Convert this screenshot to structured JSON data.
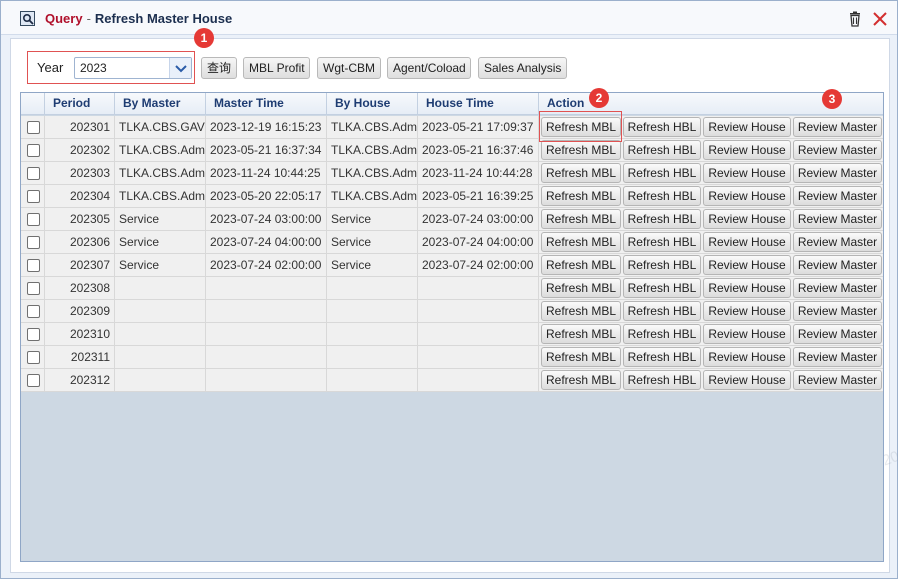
{
  "window": {
    "title_prefix": "Query",
    "title_separator": "-",
    "title_main": "Refresh Master House"
  },
  "toolbar": {
    "year_label": "Year",
    "year_value": "2023",
    "query_label": "查询",
    "mbl_profit_label": "MBL Profit",
    "wgt_cbm_label": "Wgt-CBM",
    "agent_coload_label": "Agent/Coload",
    "sales_analysis_label": "Sales Analysis"
  },
  "grid": {
    "columns": [
      "Period",
      "By Master",
      "Master Time",
      "By House",
      "House Time",
      "Action"
    ],
    "action_labels": {
      "refresh_mbl": "Refresh MBL",
      "refresh_hbl": "Refresh HBL",
      "review_house": "Review House",
      "review_master": "Review Master"
    },
    "rows": [
      {
        "period": "202301",
        "by_master": "TLKA.CBS.GAV",
        "master_time": "2023-12-19 16:15:23",
        "by_house": "TLKA.CBS.Adm",
        "house_time": "2023-05-21 17:09:37"
      },
      {
        "period": "202302",
        "by_master": "TLKA.CBS.Adm",
        "master_time": "2023-05-21 16:37:34",
        "by_house": "TLKA.CBS.Adm",
        "house_time": "2023-05-21 16:37:46"
      },
      {
        "period": "202303",
        "by_master": "TLKA.CBS.Adm",
        "master_time": "2023-11-24 10:44:25",
        "by_house": "TLKA.CBS.Adm",
        "house_time": "2023-11-24 10:44:28"
      },
      {
        "period": "202304",
        "by_master": "TLKA.CBS.Adm",
        "master_time": "2023-05-20 22:05:17",
        "by_house": "TLKA.CBS.Adm",
        "house_time": "2023-05-21 16:39:25"
      },
      {
        "period": "202305",
        "by_master": "Service",
        "master_time": "2023-07-24 03:00:00",
        "by_house": "Service",
        "house_time": "2023-07-24 03:00:00"
      },
      {
        "period": "202306",
        "by_master": "Service",
        "master_time": "2023-07-24 04:00:00",
        "by_house": "Service",
        "house_time": "2023-07-24 04:00:00"
      },
      {
        "period": "202307",
        "by_master": "Service",
        "master_time": "2023-07-24 02:00:00",
        "by_house": "Service",
        "house_time": "2023-07-24 02:00:00"
      },
      {
        "period": "202308",
        "by_master": "",
        "master_time": "",
        "by_house": "",
        "house_time": ""
      },
      {
        "period": "202309",
        "by_master": "",
        "master_time": "",
        "by_house": "",
        "house_time": ""
      },
      {
        "period": "202310",
        "by_master": "",
        "master_time": "",
        "by_house": "",
        "house_time": ""
      },
      {
        "period": "202311",
        "by_master": "",
        "master_time": "",
        "by_house": "",
        "house_time": ""
      },
      {
        "period": "202312",
        "by_master": "",
        "master_time": "",
        "by_house": "",
        "house_time": ""
      }
    ]
  },
  "annotations": {
    "badge_1": "1",
    "badge_2": "2",
    "badge_3": "3"
  },
  "watermark": "TLKA.CBS.Admin 2024-02-26",
  "icons": {
    "window_icon": "search-window-icon",
    "trash": "trash-icon",
    "close": "close-icon",
    "dropdown": "chevron-down-icon"
  },
  "colors": {
    "title_accent": "#b0102b",
    "title_text": "#1c2f4f",
    "highlight_border": "#e05252",
    "badge": "#e53935",
    "header_text": "#1e3c72",
    "grid_empty_bg": "#cdd8e3"
  }
}
